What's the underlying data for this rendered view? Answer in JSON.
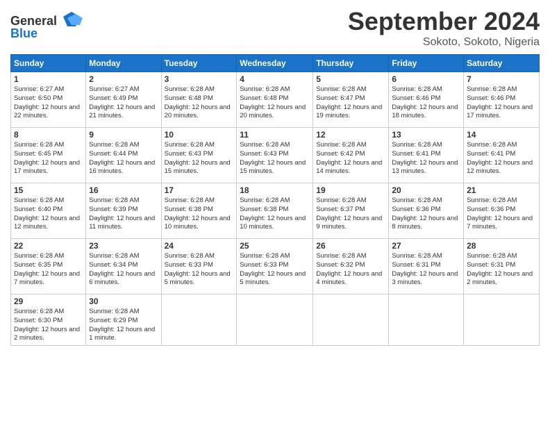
{
  "header": {
    "logo_line1": "General",
    "logo_line2": "Blue",
    "month": "September 2024",
    "location": "Sokoto, Sokoto, Nigeria"
  },
  "columns": [
    "Sunday",
    "Monday",
    "Tuesday",
    "Wednesday",
    "Thursday",
    "Friday",
    "Saturday"
  ],
  "weeks": [
    [
      {
        "day": "1",
        "sunrise": "Sunrise: 6:27 AM",
        "sunset": "Sunset: 6:50 PM",
        "daylight": "Daylight: 12 hours and 22 minutes."
      },
      {
        "day": "2",
        "sunrise": "Sunrise: 6:27 AM",
        "sunset": "Sunset: 6:49 PM",
        "daylight": "Daylight: 12 hours and 21 minutes."
      },
      {
        "day": "3",
        "sunrise": "Sunrise: 6:28 AM",
        "sunset": "Sunset: 6:48 PM",
        "daylight": "Daylight: 12 hours and 20 minutes."
      },
      {
        "day": "4",
        "sunrise": "Sunrise: 6:28 AM",
        "sunset": "Sunset: 6:48 PM",
        "daylight": "Daylight: 12 hours and 20 minutes."
      },
      {
        "day": "5",
        "sunrise": "Sunrise: 6:28 AM",
        "sunset": "Sunset: 6:47 PM",
        "daylight": "Daylight: 12 hours and 19 minutes."
      },
      {
        "day": "6",
        "sunrise": "Sunrise: 6:28 AM",
        "sunset": "Sunset: 6:46 PM",
        "daylight": "Daylight: 12 hours and 18 minutes."
      },
      {
        "day": "7",
        "sunrise": "Sunrise: 6:28 AM",
        "sunset": "Sunset: 6:46 PM",
        "daylight": "Daylight: 12 hours and 17 minutes."
      }
    ],
    [
      {
        "day": "8",
        "sunrise": "Sunrise: 6:28 AM",
        "sunset": "Sunset: 6:45 PM",
        "daylight": "Daylight: 12 hours and 17 minutes."
      },
      {
        "day": "9",
        "sunrise": "Sunrise: 6:28 AM",
        "sunset": "Sunset: 6:44 PM",
        "daylight": "Daylight: 12 hours and 16 minutes."
      },
      {
        "day": "10",
        "sunrise": "Sunrise: 6:28 AM",
        "sunset": "Sunset: 6:43 PM",
        "daylight": "Daylight: 12 hours and 15 minutes."
      },
      {
        "day": "11",
        "sunrise": "Sunrise: 6:28 AM",
        "sunset": "Sunset: 6:43 PM",
        "daylight": "Daylight: 12 hours and 15 minutes."
      },
      {
        "day": "12",
        "sunrise": "Sunrise: 6:28 AM",
        "sunset": "Sunset: 6:42 PM",
        "daylight": "Daylight: 12 hours and 14 minutes."
      },
      {
        "day": "13",
        "sunrise": "Sunrise: 6:28 AM",
        "sunset": "Sunset: 6:41 PM",
        "daylight": "Daylight: 12 hours and 13 minutes."
      },
      {
        "day": "14",
        "sunrise": "Sunrise: 6:28 AM",
        "sunset": "Sunset: 6:41 PM",
        "daylight": "Daylight: 12 hours and 12 minutes."
      }
    ],
    [
      {
        "day": "15",
        "sunrise": "Sunrise: 6:28 AM",
        "sunset": "Sunset: 6:40 PM",
        "daylight": "Daylight: 12 hours and 12 minutes."
      },
      {
        "day": "16",
        "sunrise": "Sunrise: 6:28 AM",
        "sunset": "Sunset: 6:39 PM",
        "daylight": "Daylight: 12 hours and 11 minutes."
      },
      {
        "day": "17",
        "sunrise": "Sunrise: 6:28 AM",
        "sunset": "Sunset: 6:38 PM",
        "daylight": "Daylight: 12 hours and 10 minutes."
      },
      {
        "day": "18",
        "sunrise": "Sunrise: 6:28 AM",
        "sunset": "Sunset: 6:38 PM",
        "daylight": "Daylight: 12 hours and 10 minutes."
      },
      {
        "day": "19",
        "sunrise": "Sunrise: 6:28 AM",
        "sunset": "Sunset: 6:37 PM",
        "daylight": "Daylight: 12 hours and 9 minutes."
      },
      {
        "day": "20",
        "sunrise": "Sunrise: 6:28 AM",
        "sunset": "Sunset: 6:36 PM",
        "daylight": "Daylight: 12 hours and 8 minutes."
      },
      {
        "day": "21",
        "sunrise": "Sunrise: 6:28 AM",
        "sunset": "Sunset: 6:36 PM",
        "daylight": "Daylight: 12 hours and 7 minutes."
      }
    ],
    [
      {
        "day": "22",
        "sunrise": "Sunrise: 6:28 AM",
        "sunset": "Sunset: 6:35 PM",
        "daylight": "Daylight: 12 hours and 7 minutes."
      },
      {
        "day": "23",
        "sunrise": "Sunrise: 6:28 AM",
        "sunset": "Sunset: 6:34 PM",
        "daylight": "Daylight: 12 hours and 6 minutes."
      },
      {
        "day": "24",
        "sunrise": "Sunrise: 6:28 AM",
        "sunset": "Sunset: 6:33 PM",
        "daylight": "Daylight: 12 hours and 5 minutes."
      },
      {
        "day": "25",
        "sunrise": "Sunrise: 6:28 AM",
        "sunset": "Sunset: 6:33 PM",
        "daylight": "Daylight: 12 hours and 5 minutes."
      },
      {
        "day": "26",
        "sunrise": "Sunrise: 6:28 AM",
        "sunset": "Sunset: 6:32 PM",
        "daylight": "Daylight: 12 hours and 4 minutes."
      },
      {
        "day": "27",
        "sunrise": "Sunrise: 6:28 AM",
        "sunset": "Sunset: 6:31 PM",
        "daylight": "Daylight: 12 hours and 3 minutes."
      },
      {
        "day": "28",
        "sunrise": "Sunrise: 6:28 AM",
        "sunset": "Sunset: 6:31 PM",
        "daylight": "Daylight: 12 hours and 2 minutes."
      }
    ],
    [
      {
        "day": "29",
        "sunrise": "Sunrise: 6:28 AM",
        "sunset": "Sunset: 6:30 PM",
        "daylight": "Daylight: 12 hours and 2 minutes."
      },
      {
        "day": "30",
        "sunrise": "Sunrise: 6:28 AM",
        "sunset": "Sunset: 6:29 PM",
        "daylight": "Daylight: 12 hours and 1 minute."
      },
      null,
      null,
      null,
      null,
      null
    ]
  ]
}
